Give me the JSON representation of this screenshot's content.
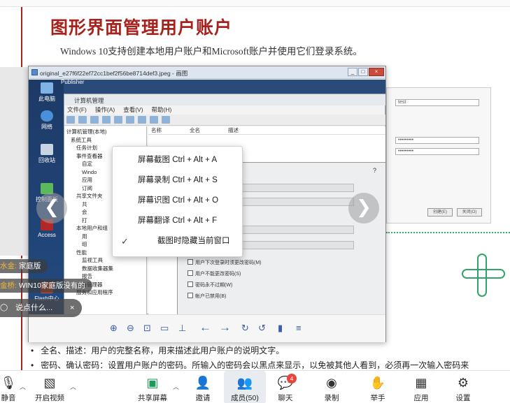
{
  "document": {
    "title": "图形界面管理用户账户",
    "subtitle": "Windows 10支持创建本地用户账户和Microsoft账户并使用它们登录系统。",
    "bullets": [
      "全名、描述：用户的完整名称，用来描述此用户账户的说明文字。",
      "密码、确认密码：设置用户账户的密码。所输入的密码会以黑点来显示，以免被其他人看到，必须再一次输入密码来"
    ]
  },
  "viewer": {
    "title": "original_e27f6f22ef72cc1bef2f56be8714def3.jpeg - 画图",
    "minimize": "_",
    "maximize": "□",
    "close": "×",
    "mgmt_title": "计算机管理",
    "menu": [
      "文件(F)",
      "操作(A)",
      "查看(V)",
      "帮助(H)"
    ],
    "tree": [
      "计算机管理(本地)",
      "系统工具",
      "任务计划",
      "事件查看器",
      "自定",
      "Windo",
      "应用",
      "订阅",
      "共享文件夹",
      "共",
      "会",
      "打",
      "本地用户和组",
      "用",
      "组",
      "性能",
      "监视工具",
      "数据收集器集",
      "报告",
      "设备管理器",
      "服务和应用程序"
    ],
    "columns": [
      "名称",
      "全名",
      "描述"
    ],
    "dialog_checks": [
      "用户下次登录时须更改密码(M)",
      "用户不能更改密码(S)",
      "密码永不过期(W)",
      "帐户已禁用(B)"
    ],
    "dialog_q": "?",
    "desktop_icons": [
      "此电脑",
      "Publisher",
      "网络",
      "回收站",
      "控制面板",
      "Access",
      "Flash中心"
    ],
    "prev_arrow": "❮",
    "next_arrow": "❯"
  },
  "popup": {
    "items": [
      "屏幕截图 Ctrl + Alt + A",
      "屏幕录制 Ctrl + Alt + S",
      "屏幕识图 Ctrl + Alt + O",
      "屏幕翻译 Ctrl + Alt + F"
    ],
    "check_item": "截图时隐藏当前窗口",
    "check_mark": "✓"
  },
  "chat": {
    "messages": [
      {
        "name": "水金:",
        "text": "家庭版"
      },
      {
        "name": "金桥:",
        "text": "WIN10家庭版没有的"
      }
    ],
    "input_placeholder": "说点什么...",
    "input_close": "×"
  },
  "fragment": {
    "field1": "test",
    "pwd1": "•••••••••",
    "pwd2": "•••••••••",
    "create": "创建(E)",
    "close": "关闭(O)"
  },
  "toolbar": {
    "mute_label": "静音",
    "video_label": "开启视频",
    "share_label": "共享屏幕",
    "invite_label": "邀请",
    "members_label": "成员(50)",
    "chat_label": "聊天",
    "chat_badge": "4",
    "record_label": "录制",
    "raise_label": "举手",
    "apps_label": "应用",
    "settings_label": "设置"
  },
  "colors": {
    "title_red": "#a8221d",
    "deco_green": "#2fa56a",
    "badge_red": "#e8453c"
  }
}
